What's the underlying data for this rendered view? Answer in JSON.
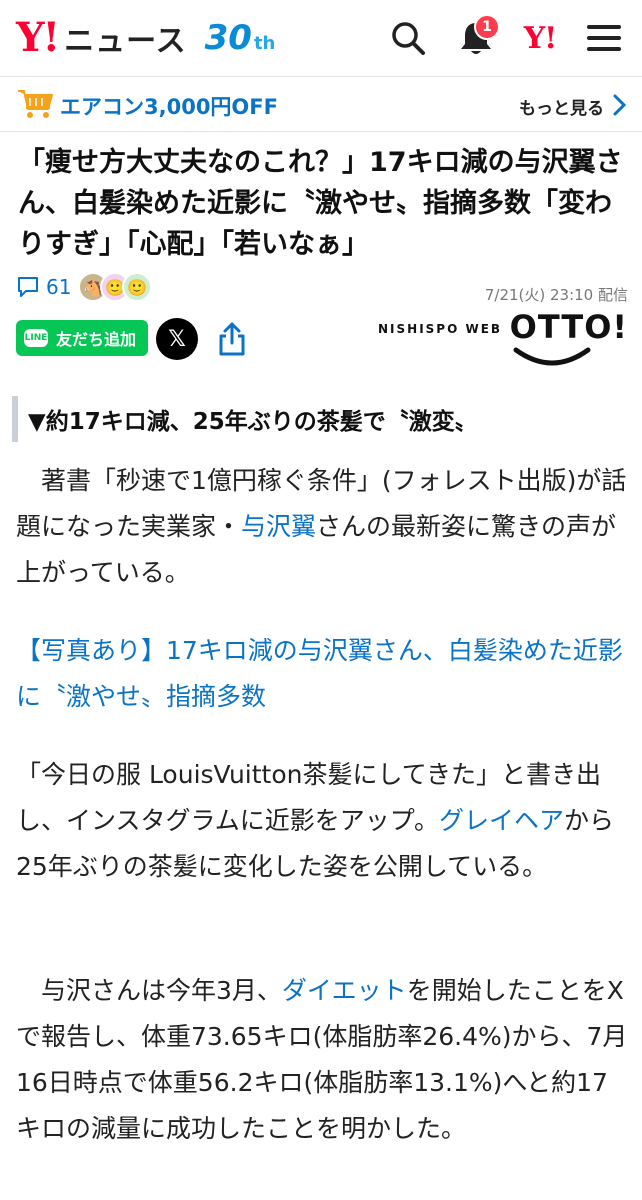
{
  "header": {
    "logo_y": "Y!",
    "logo_news": "ニュース",
    "logo_30": "30",
    "logo_th": "th",
    "bell_badge": "1",
    "yj_logo": "Y!",
    "icons": [
      "search-icon",
      "bell-icon",
      "menu-icon"
    ]
  },
  "promo": {
    "text": "エアコン3,000円OFF",
    "more": "もっと見る"
  },
  "article": {
    "title": "「痩せ方大丈夫なのこれ？」17キロ減の与沢翼さん、白髪染めた近影に〝激やせ〟指摘多数「変わりすぎ」「心配」「若いなぁ」",
    "comment_count": "61",
    "date": "7/21(火) 23:10 配信",
    "line_badge": "LINE",
    "line_button": "友だち追加",
    "x_button": "𝕏",
    "publisher_small": "NISHISPO WEB",
    "publisher_big": "OTTO!",
    "subheading": "▼約17キロ減、25年ぶりの茶髪で〝激変〟",
    "p1_a": "　著書「秒速で1億円稼ぐ条件」(フォレスト出版)が話題になった実業家・",
    "p1_link": "与沢翼",
    "p1_b": "さんの最新姿に驚きの声が上がっている。",
    "photo_link": "【写真あり】17キロ減の与沢翼さん、白髪染めた近影に〝激やせ〟指摘多数",
    "p2_a": "「今日の服 LouisVuitton茶髪にしてきた」と書き出し、インスタグラムに近影をアップ。",
    "p2_link": "グレイヘア",
    "p2_b": "から25年ぶりの茶髪に変化した姿を公開している。",
    "p3_a": "　与沢さんは今年3月、",
    "p3_link": "ダイエット",
    "p3_b": "を開始したことをXで報告し、体重73.65キロ(体脂肪率26.4%)から、7月16日時点で体重56.2キロ(体脂肪率13.1%)へと約17キロの減量に成功したことを明かした。"
  },
  "colors": {
    "brand_red": "#ff0033",
    "link_blue": "#0b73c6",
    "line_green": "#06c755",
    "badge_red": "#ff3b4e"
  }
}
